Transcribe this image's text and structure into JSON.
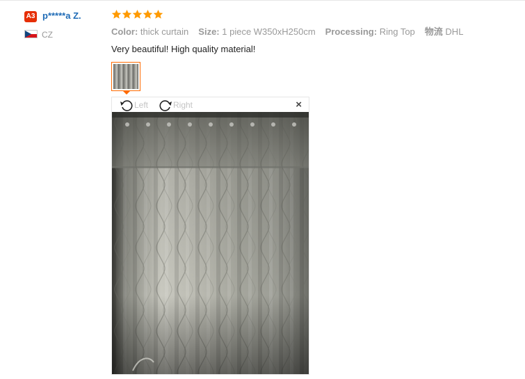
{
  "reviewer": {
    "level_badge": "A3",
    "name": "p*****a Z.",
    "country": "CZ"
  },
  "rating": {
    "stars": 5,
    "max": 5
  },
  "attributes": [
    {
      "key": "Color:",
      "value": "thick curtain"
    },
    {
      "key": "Size:",
      "value": "1 piece W350xH250cm"
    },
    {
      "key": "Processing:",
      "value": "Ring Top"
    },
    {
      "key": "物流",
      "value": "DHL"
    }
  ],
  "feedback": "Very beautiful! High quality material!",
  "viewer": {
    "rotate_left_label": "Left",
    "rotate_right_label": "Right",
    "close_symbol": "×"
  },
  "colors": {
    "star": "#ff9a00",
    "accent": "#ff6a00",
    "username": "#1f6bb6",
    "badge": "#e62e04"
  }
}
